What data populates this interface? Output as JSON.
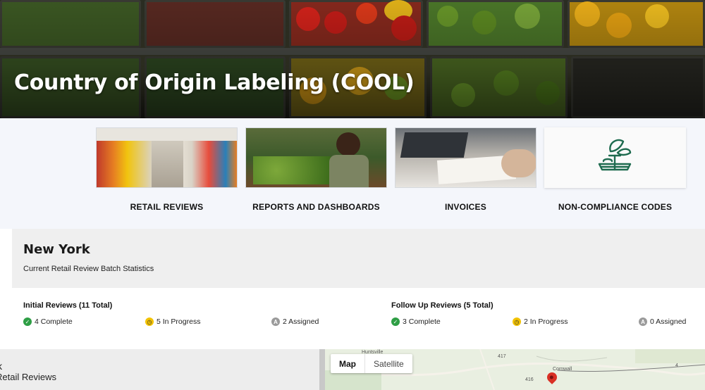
{
  "hero": {
    "title": "Country of Origin Labeling (COOL)"
  },
  "cards": [
    {
      "label": "RETAIL REVIEWS"
    },
    {
      "label": "REPORTS AND DASHBOARDS"
    },
    {
      "label": "INVOICES"
    },
    {
      "label": "NON-COMPLIANCE CODES",
      "icon": "scale-produce-icon"
    }
  ],
  "stats": {
    "state": "New York",
    "subtitle": "Current Retail Review Batch Statistics",
    "initial": {
      "title": "Initial Reviews (11 Total)",
      "complete": "4 Complete",
      "in_progress": "5 In Progress",
      "assigned": "2 Assigned"
    },
    "follow_up": {
      "title": "Follow Up Reviews (5 Total)",
      "complete": "3 Complete",
      "in_progress": "2 In Progress",
      "assigned": "0 Assigned"
    }
  },
  "list_panel": {
    "back_label": "k",
    "title": "Retail Reviews"
  },
  "map": {
    "tabs": [
      "Map",
      "Satellite"
    ],
    "labels": [
      "Huntsville",
      "Cornwall",
      "417",
      "416",
      "4"
    ]
  },
  "colors": {
    "complete": "#2e9e45",
    "in_progress": "#f2c200",
    "assigned": "#9a9a9a",
    "accent": "#1e6b4f"
  }
}
